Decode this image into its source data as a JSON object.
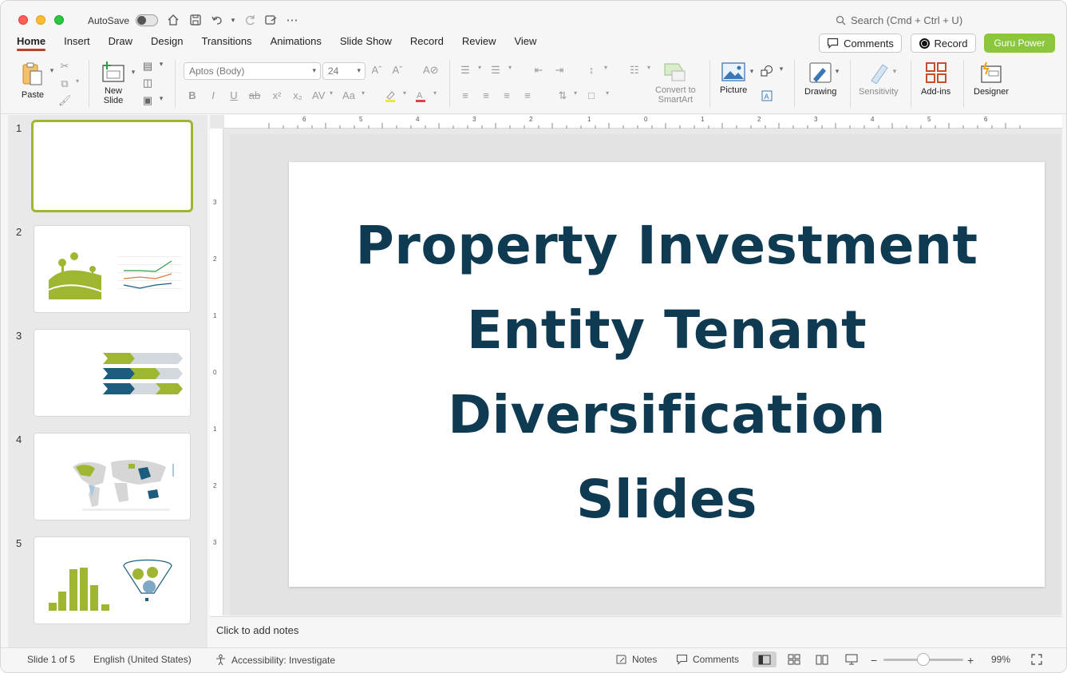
{
  "titlebar": {
    "autosave_label": "AutoSave",
    "search_placeholder": "Search (Cmd + Ctrl + U)"
  },
  "tabs": [
    {
      "label": "Home",
      "active": true
    },
    {
      "label": "Insert"
    },
    {
      "label": "Draw"
    },
    {
      "label": "Design"
    },
    {
      "label": "Transitions"
    },
    {
      "label": "Animations"
    },
    {
      "label": "Slide Show"
    },
    {
      "label": "Record"
    },
    {
      "label": "Review"
    },
    {
      "label": "View"
    }
  ],
  "header_buttons": {
    "comments": "Comments",
    "record": "Record",
    "guru": "Guru Power",
    "guru_color": "#8cc63f"
  },
  "ribbon": {
    "paste": "Paste",
    "new_slide_1": "New",
    "new_slide_2": "Slide",
    "font_name": "Aptos (Body)",
    "font_size": "24",
    "smartart_1": "Convert to",
    "smartart_2": "SmartArt",
    "picture": "Picture",
    "drawing": "Drawing",
    "sensitivity": "Sensitivity",
    "addins": "Add-ins",
    "designer": "Designer"
  },
  "thumbnails": [
    {
      "num": "1",
      "selected": true
    },
    {
      "num": "2"
    },
    {
      "num": "3"
    },
    {
      "num": "4"
    },
    {
      "num": "5"
    }
  ],
  "ruler": {
    "h_labels": [
      "6",
      "5",
      "4",
      "3",
      "2",
      "1",
      "0",
      "1",
      "2",
      "3",
      "4",
      "5",
      "6"
    ],
    "v_labels": [
      "3",
      "2",
      "1",
      "0",
      "1",
      "2",
      "3"
    ]
  },
  "slide": {
    "title_lines": [
      "Property Investment",
      "Entity Tenant",
      "Diversification",
      "Slides"
    ],
    "title_color": "#0e3a52"
  },
  "notes_placeholder": "Click to add notes",
  "status": {
    "slide_info": "Slide 1 of 5",
    "language": "English (United States)",
    "accessibility": "Accessibility: Investigate",
    "notes": "Notes",
    "comments": "Comments",
    "zoom": "99%"
  },
  "colors": {
    "accent_green": "#9db733",
    "accent_blue": "#1c5c7f",
    "tab_underline": "#b5402f"
  }
}
